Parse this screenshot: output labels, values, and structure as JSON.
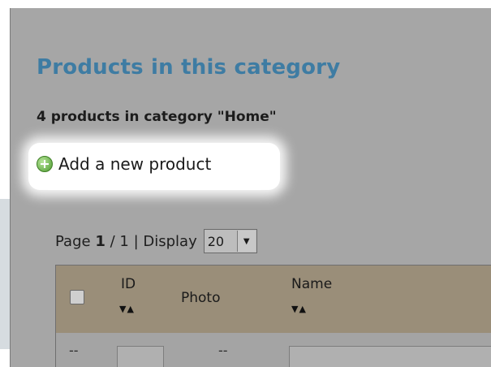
{
  "section": {
    "title": "Products in this category",
    "count_text": "4 products in category \"Home\""
  },
  "actions": {
    "add_product_label": "Add a new product",
    "add_product_icon": "plus-circle-icon"
  },
  "pagination": {
    "page_word": "Page",
    "current_page": "1",
    "separator": "/",
    "total_pages": "1",
    "pipe": "|",
    "display_word": "Display",
    "per_page_selected": "20"
  },
  "table": {
    "columns": [
      {
        "label": "ID",
        "sortable": true
      },
      {
        "label": "Photo",
        "sortable": false
      },
      {
        "label": "Name",
        "sortable": true
      }
    ],
    "sort_glyphs": "▼▲",
    "filter_row": {
      "id_placeholder": "--",
      "photo_placeholder": "--"
    }
  },
  "colors": {
    "title": "#3e7ca3",
    "header_bg": "#9a8e79",
    "overlay": "#a6a6a6"
  }
}
